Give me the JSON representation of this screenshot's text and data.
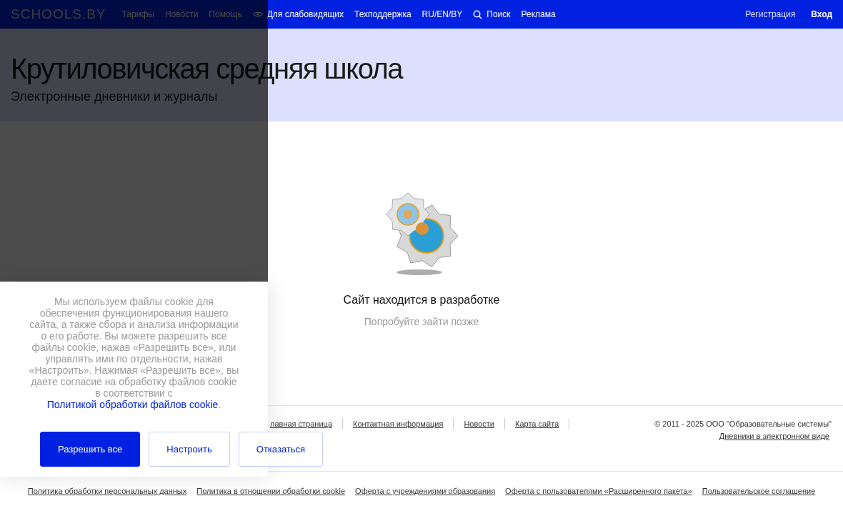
{
  "nav": {
    "logo": "SCHOOLS.BY",
    "items": [
      {
        "label": "Тарифы",
        "kind": "link"
      },
      {
        "label": "Новости",
        "kind": "link"
      },
      {
        "label": "Помощь",
        "kind": "link"
      },
      {
        "label": "Для слабовидящих",
        "kind": "eye"
      },
      {
        "label": "Техподдержка",
        "kind": "link"
      },
      {
        "label": "RU/EN/BY",
        "kind": "link"
      },
      {
        "label": "Поиск",
        "kind": "search"
      },
      {
        "label": "Реклама",
        "kind": "link"
      }
    ],
    "right": [
      {
        "label": "Регистрация",
        "bold": false
      },
      {
        "label": "Вход",
        "bold": true
      }
    ]
  },
  "header": {
    "title": "Крутиловичская средняя школа",
    "subtitle": "Электронные дневники и журналы"
  },
  "main": {
    "heading": "Сайт находится в разработке",
    "note": "Попробуйте зайти позже"
  },
  "footer": {
    "links": [
      "лавная страница",
      "Контактная информация",
      "Новости",
      "Карта сайта"
    ],
    "copyright": "© 2011 - 2025 ООО \"Образовательные системы\"",
    "tagline": "Дневники в электронном виде",
    "bottom_links": [
      "Политика обработки персональных данных",
      "Политика в отношении обработки cookie",
      "Оферта с учреждениями образования",
      "Оферта с пользователями «Расширенного пакета»",
      "Пользовательское соглашение"
    ]
  },
  "cookie": {
    "text_before": "Мы используем файлы cookie для обеспечения функционирования нашего сайта, а также сбора и анализа информации о его работе. Вы можете разрешить все файлы cookie, нажав «Разрешить все», или управлять ими по отдельности, нажав «Настроить». Нажимая «Разрешить все», вы даете согласие на обработку файлов cookie в соответствии с",
    "link": "Политикой обработки файлов cookie",
    "text_after": ".",
    "buttons": [
      {
        "label": "Разрешить все",
        "primary": true
      },
      {
        "label": "Настроить",
        "primary": false
      },
      {
        "label": "Отказаться",
        "primary": false
      }
    ]
  }
}
